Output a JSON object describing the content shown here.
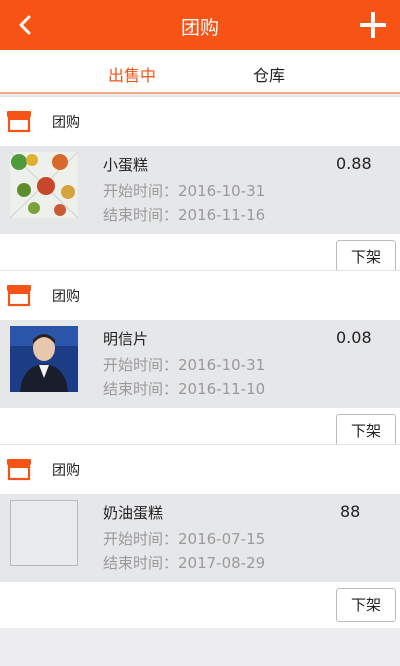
{
  "header": {
    "title": "团购",
    "back_icon": "chevron-left-icon",
    "add_icon": "plus-icon",
    "color": "#f65314"
  },
  "tabs": [
    {
      "label": "出售中",
      "active": true
    },
    {
      "label": "仓库",
      "active": false
    }
  ],
  "sections": [
    {
      "label": "团购",
      "icon": "shop-icon",
      "item": {
        "name": "小蛋糕",
        "price": "0.88",
        "start": "开始时间：2016-10-31",
        "end": "结束时间：2016-11-16",
        "thumb": "cake-photo"
      },
      "action": "下架"
    },
    {
      "label": "团购",
      "icon": "shop-icon",
      "item": {
        "name": "明信片",
        "price": "0.08",
        "start": "开始时间：2016-10-31",
        "end": "结束时间：2016-11-10",
        "thumb": "person-photo"
      },
      "action": "下架"
    },
    {
      "label": "团购",
      "icon": "shop-icon",
      "item": {
        "name": "奶油蛋糕",
        "price": "88",
        "start": "开始时间：2016-07-15",
        "end": "结束时间：2017-08-29",
        "thumb": "empty"
      },
      "action": "下架"
    }
  ]
}
